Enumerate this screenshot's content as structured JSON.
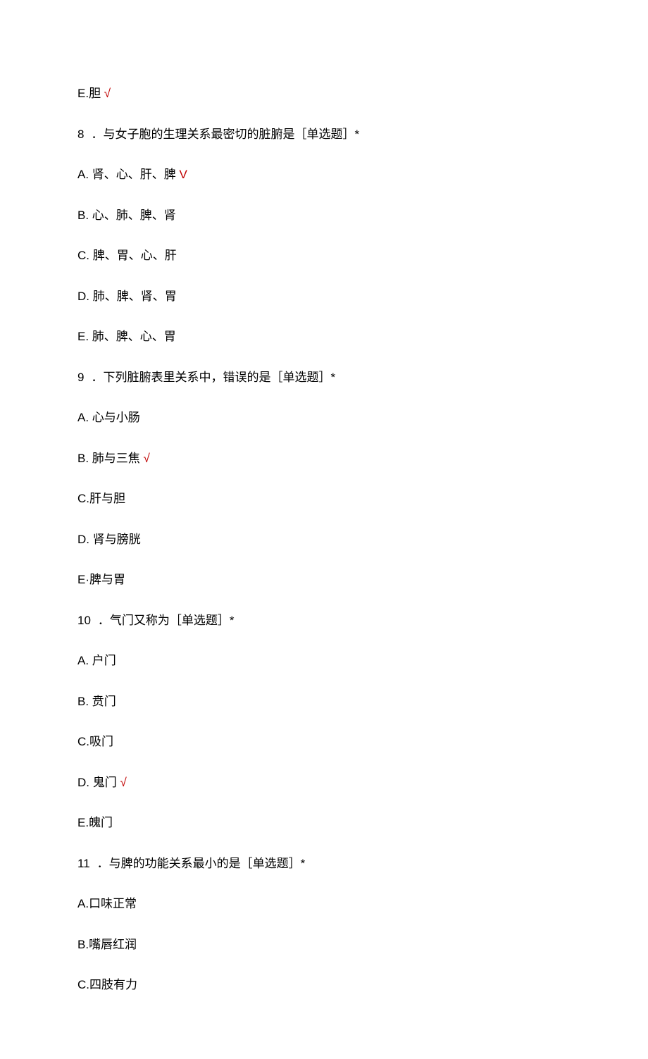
{
  "top_line": {
    "letter": "E.",
    "text": "胆",
    "mark": "√"
  },
  "q8": {
    "num": "8",
    "stem": "．与女子胞的生理关系最密切的脏腑是［单选题］*",
    "opts": [
      {
        "letter": "A.",
        "text": "肾、心、肝、脾",
        "mark": "V",
        "correct": true
      },
      {
        "letter": "B.",
        "text": "心、肺、脾、肾"
      },
      {
        "letter": "C.",
        "text": "脾、胃、心、肝"
      },
      {
        "letter": "D.",
        "text": "肺、脾、肾、胃"
      },
      {
        "letter": "E.",
        "text": "肺、脾、心、胃"
      }
    ]
  },
  "q9": {
    "num": "9",
    "stem": "．下列脏腑表里关系中，错误的是［单选题］*",
    "opts": [
      {
        "letter": "A.",
        "text": "心与小肠"
      },
      {
        "letter": "B.",
        "text": "肺与三焦",
        "mark": "√",
        "correct": true
      },
      {
        "letter": "C.",
        "text": "肝与胆"
      },
      {
        "letter": "D.",
        "text": "肾与膀胱"
      },
      {
        "letter": "E·",
        "text": "脾与胃"
      }
    ]
  },
  "q10": {
    "num": "10",
    "stem": "．气门又称为［单选题］*",
    "opts": [
      {
        "letter": "A.",
        "text": "户门"
      },
      {
        "letter": "B.",
        "text": "贲门"
      },
      {
        "letter": "C.",
        "text": "吸门"
      },
      {
        "letter": "D.",
        "text": "鬼门",
        "mark": "√",
        "correct": true
      },
      {
        "letter": "E.",
        "text": "魄门"
      }
    ]
  },
  "q11": {
    "num": "11",
    "stem": "．与脾的功能关系最小的是［单选题］*",
    "opts": [
      {
        "letter": "A.",
        "text": "口味正常"
      },
      {
        "letter": "B.",
        "text": "嘴唇红润"
      },
      {
        "letter": "C.",
        "text": "四肢有力"
      }
    ]
  }
}
